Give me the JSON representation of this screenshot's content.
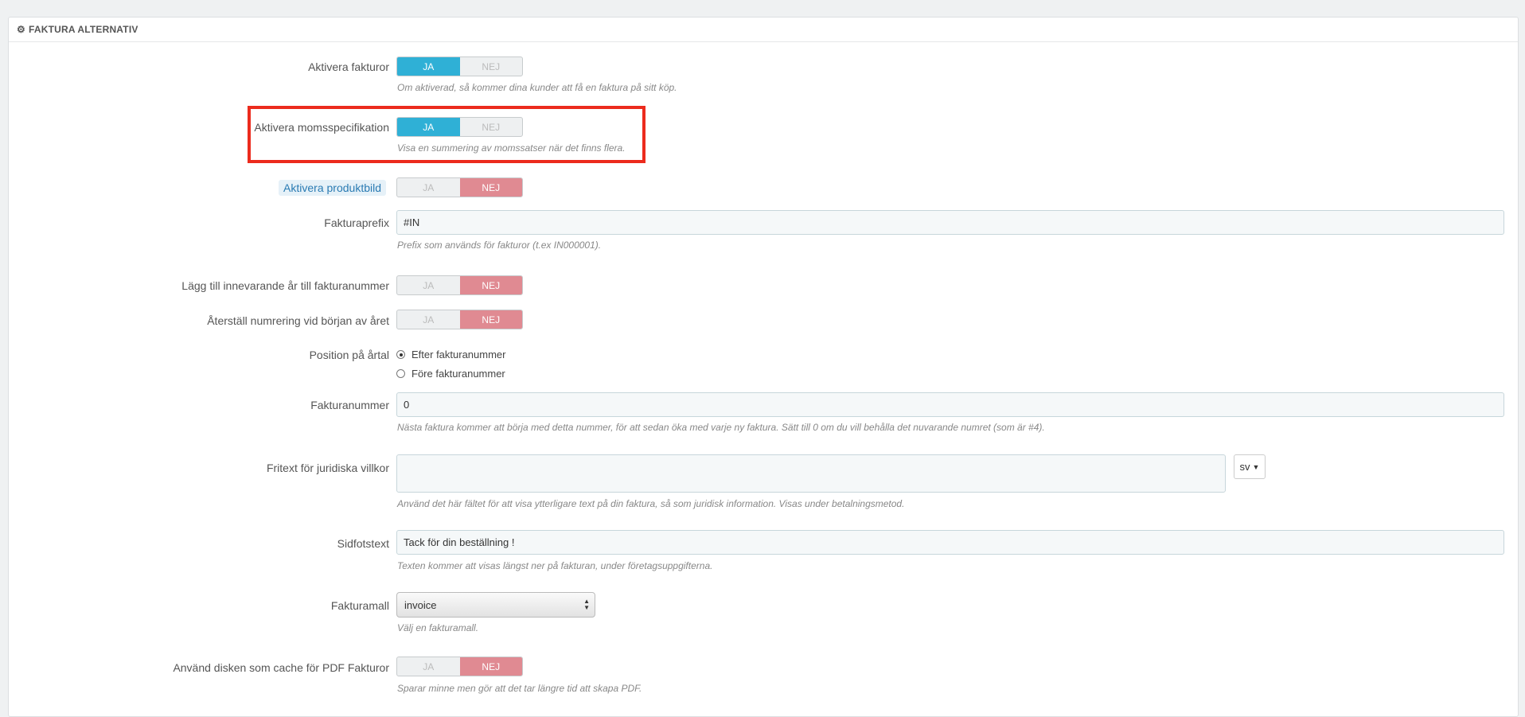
{
  "header": {
    "title": "FAKTURA ALTERNATIV",
    "icon": "gears-icon"
  },
  "switch_labels": {
    "yes": "JA",
    "no": "NEJ"
  },
  "fields": {
    "aktivera_fakturor": {
      "label": "Aktivera fakturor",
      "value": "JA",
      "help": "Om aktiverad, så kommer dina kunder att få en faktura på sitt köp."
    },
    "momsspec": {
      "label": "Aktivera momsspecifikation",
      "value": "JA",
      "help": "Visa en summering av momssatser när det finns flera."
    },
    "produktbild": {
      "label": "Aktivera produktbild",
      "value": "NEJ"
    },
    "prefix": {
      "label": "Fakturaprefix",
      "value": "#IN",
      "help": "Prefix som används för fakturor (t.ex IN000001)."
    },
    "ar_nummer": {
      "label": "Lägg till innevarande år till fakturanummer",
      "value": "NEJ"
    },
    "aterstall": {
      "label": "Återställ numrering vid början av året",
      "value": "NEJ"
    },
    "position": {
      "label": "Position på årtal",
      "options": [
        "Efter fakturanummer",
        "Före fakturanummer"
      ],
      "selected": "Efter fakturanummer"
    },
    "fakturanummer": {
      "label": "Fakturanummer",
      "value": "0",
      "help": "Nästa faktura kommer att börja med detta nummer, för att sedan öka med varje ny faktura. Sätt till 0 om du vill behålla det nuvarande numret (som är #4)."
    },
    "fritext": {
      "label": "Fritext för juridiska villkor",
      "value": "",
      "lang": "sv",
      "help": "Använd det här fältet för att visa ytterligare text på din faktura, så som juridisk information. Visas under betalningsmetod."
    },
    "sidfot": {
      "label": "Sidfotstext",
      "value": "Tack för din beställning !",
      "help": "Texten kommer att visas längst ner på fakturan, under företagsuppgifterna."
    },
    "fakturamall": {
      "label": "Fakturamall",
      "value": "invoice",
      "help": "Välj en fakturamall."
    },
    "cache": {
      "label": "Använd disken som cache för PDF Fakturor",
      "value": "NEJ",
      "help": "Sparar minne men gör att det tar längre tid att skapa PDF."
    }
  },
  "colors": {
    "switch_yes": "#2fb0d6",
    "switch_no": "#e08a92",
    "highlight": "#ec2b1d"
  }
}
